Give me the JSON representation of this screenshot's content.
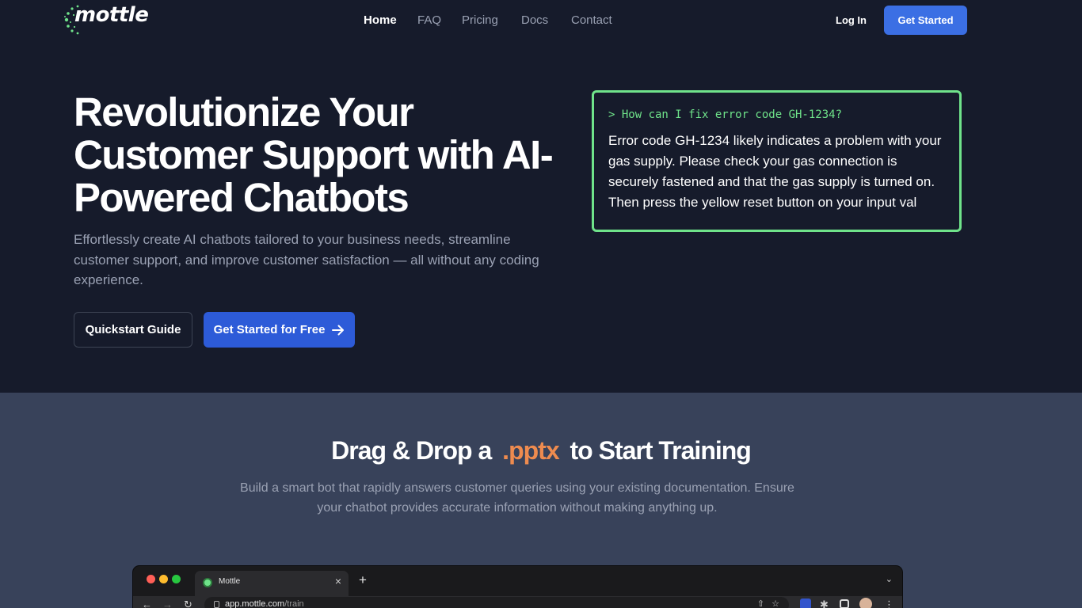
{
  "header": {
    "logo_text": "mottle",
    "nav": [
      "Home",
      "FAQ",
      "Pricing",
      "Docs",
      "Contact"
    ],
    "active_nav": "Home",
    "login_label": "Log In",
    "cta_label": "Get Started"
  },
  "hero": {
    "title": "Revolutionize Your Customer Support with AI-Powered Chatbots",
    "subtitle": "Effortlessly create AI chatbots tailored to your business needs, streamline customer support, and improve customer satisfaction — all without any coding experience.",
    "secondary_button": "Quickstart Guide",
    "primary_button": "Get Started for Free"
  },
  "terminal": {
    "prompt": "> How can I fix error code GH-1234?",
    "answer": "Error code GH-1234 likely indicates a problem with your gas supply. Please check your gas connection is securely fastened and that the gas supply is turned on. Then press the yellow reset button on your input val"
  },
  "training": {
    "title_before": "Drag & Drop a",
    "title_accent": ".pptx",
    "title_after": "to Start Training",
    "subtitle": "Build a smart bot that rapidly answers customer queries using your existing documentation. Ensure your chatbot provides accurate information without making anything up."
  },
  "browser": {
    "tab_title": "Mottle",
    "url_host": "app.mottle.com",
    "url_path": "/train"
  },
  "colors": {
    "background": "#161b2b",
    "section_background": "#38425a",
    "primary": "#2d5bd8",
    "terminal_border": "#6fe38a",
    "accent": "#ee8b4f"
  }
}
